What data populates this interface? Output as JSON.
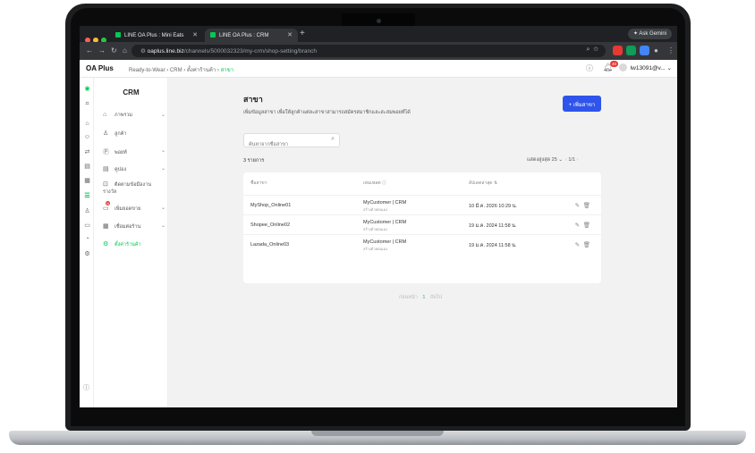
{
  "browser": {
    "tabs": [
      {
        "label": "LINE OA Plus : Mini Eats"
      },
      {
        "label": "LINE OA Plus : CRM"
      }
    ],
    "gemini_label": "Ask Gemini",
    "url_domain": "oaplus.line.biz",
    "url_path": "/channels/5000032323/my-crm/shop-setting/branch"
  },
  "app": {
    "brand": "OA Plus",
    "breadcrumbs": [
      "Ready-to-Wear",
      "CRM",
      "ตั้งค่าร้านค้า",
      "สาขา"
    ],
    "notification_count": "40",
    "user_name": "lw13091@v..."
  },
  "sidebar": {
    "title": "CRM",
    "items": [
      {
        "label": "ภาพรวม",
        "icon": "home-icon",
        "chev": "⌄"
      },
      {
        "label": "ลูกค้า",
        "icon": "user-icon",
        "chev": ""
      },
      {
        "label": "พอยท์",
        "icon": "points-icon",
        "chev": "⌄"
      },
      {
        "label": "คูปอง",
        "icon": "coupon-icon",
        "chev": "⌄"
      },
      {
        "label": "ติดตามข้อมืองาน รางวัล",
        "icon": "gift-icon",
        "chev": ""
      },
      {
        "label": "เพิ่มยอดขาย",
        "icon": "sales-icon",
        "chev": "⌄"
      },
      {
        "label": "เชื่อมต่อร้าน",
        "icon": "store-icon",
        "chev": "⌄"
      },
      {
        "label": "ตั้งค่าร้านค้า",
        "icon": "gear-icon",
        "chev": ""
      }
    ]
  },
  "page": {
    "title": "สาขา",
    "description": "เพิ่มข้อมูลสาขา เพื่อให้ลูกค้าแต่ละสาขาสามารถสมัครสมาชิกและสะสมพอยท์ได้",
    "add_button": "+ เพิ่มสาขา",
    "search_placeholder": "ค้นหาจากชื่อสาขา",
    "count_text": "3 รายการ",
    "per_page_label": "แสดงสูงสุด",
    "per_page_value": "25",
    "page_indicator": "1/1",
    "columns": [
      "ชื่อสาขา",
      "เทมเพลต ⓘ",
      "อัปเดตล่าสุด ⇅"
    ],
    "rows": [
      {
        "name": "MyShop_Online01",
        "template": "MyCustomer | CRM",
        "template_sub": "สร้างด้วยตนเอง",
        "updated": "10 มี.ค. 2026 10:29 น."
      },
      {
        "name": "Shopee_Online02",
        "template": "MyCustomer | CRM",
        "template_sub": "สร้างด้วยตนเอง",
        "updated": "19 ม.ค. 2024 11:58 น."
      },
      {
        "name": "Lazada_Online03",
        "template": "MyCustomer | CRM",
        "template_sub": "สร้างด้วยตนเอง",
        "updated": "19 ม.ค. 2024 11:58 น."
      }
    ],
    "pager_prev": "ก่อนหน้า",
    "pager_current": "1",
    "pager_next": "ถัดไป"
  },
  "colors": {
    "accent": "#06c755",
    "primary_button": "#2f54eb"
  }
}
